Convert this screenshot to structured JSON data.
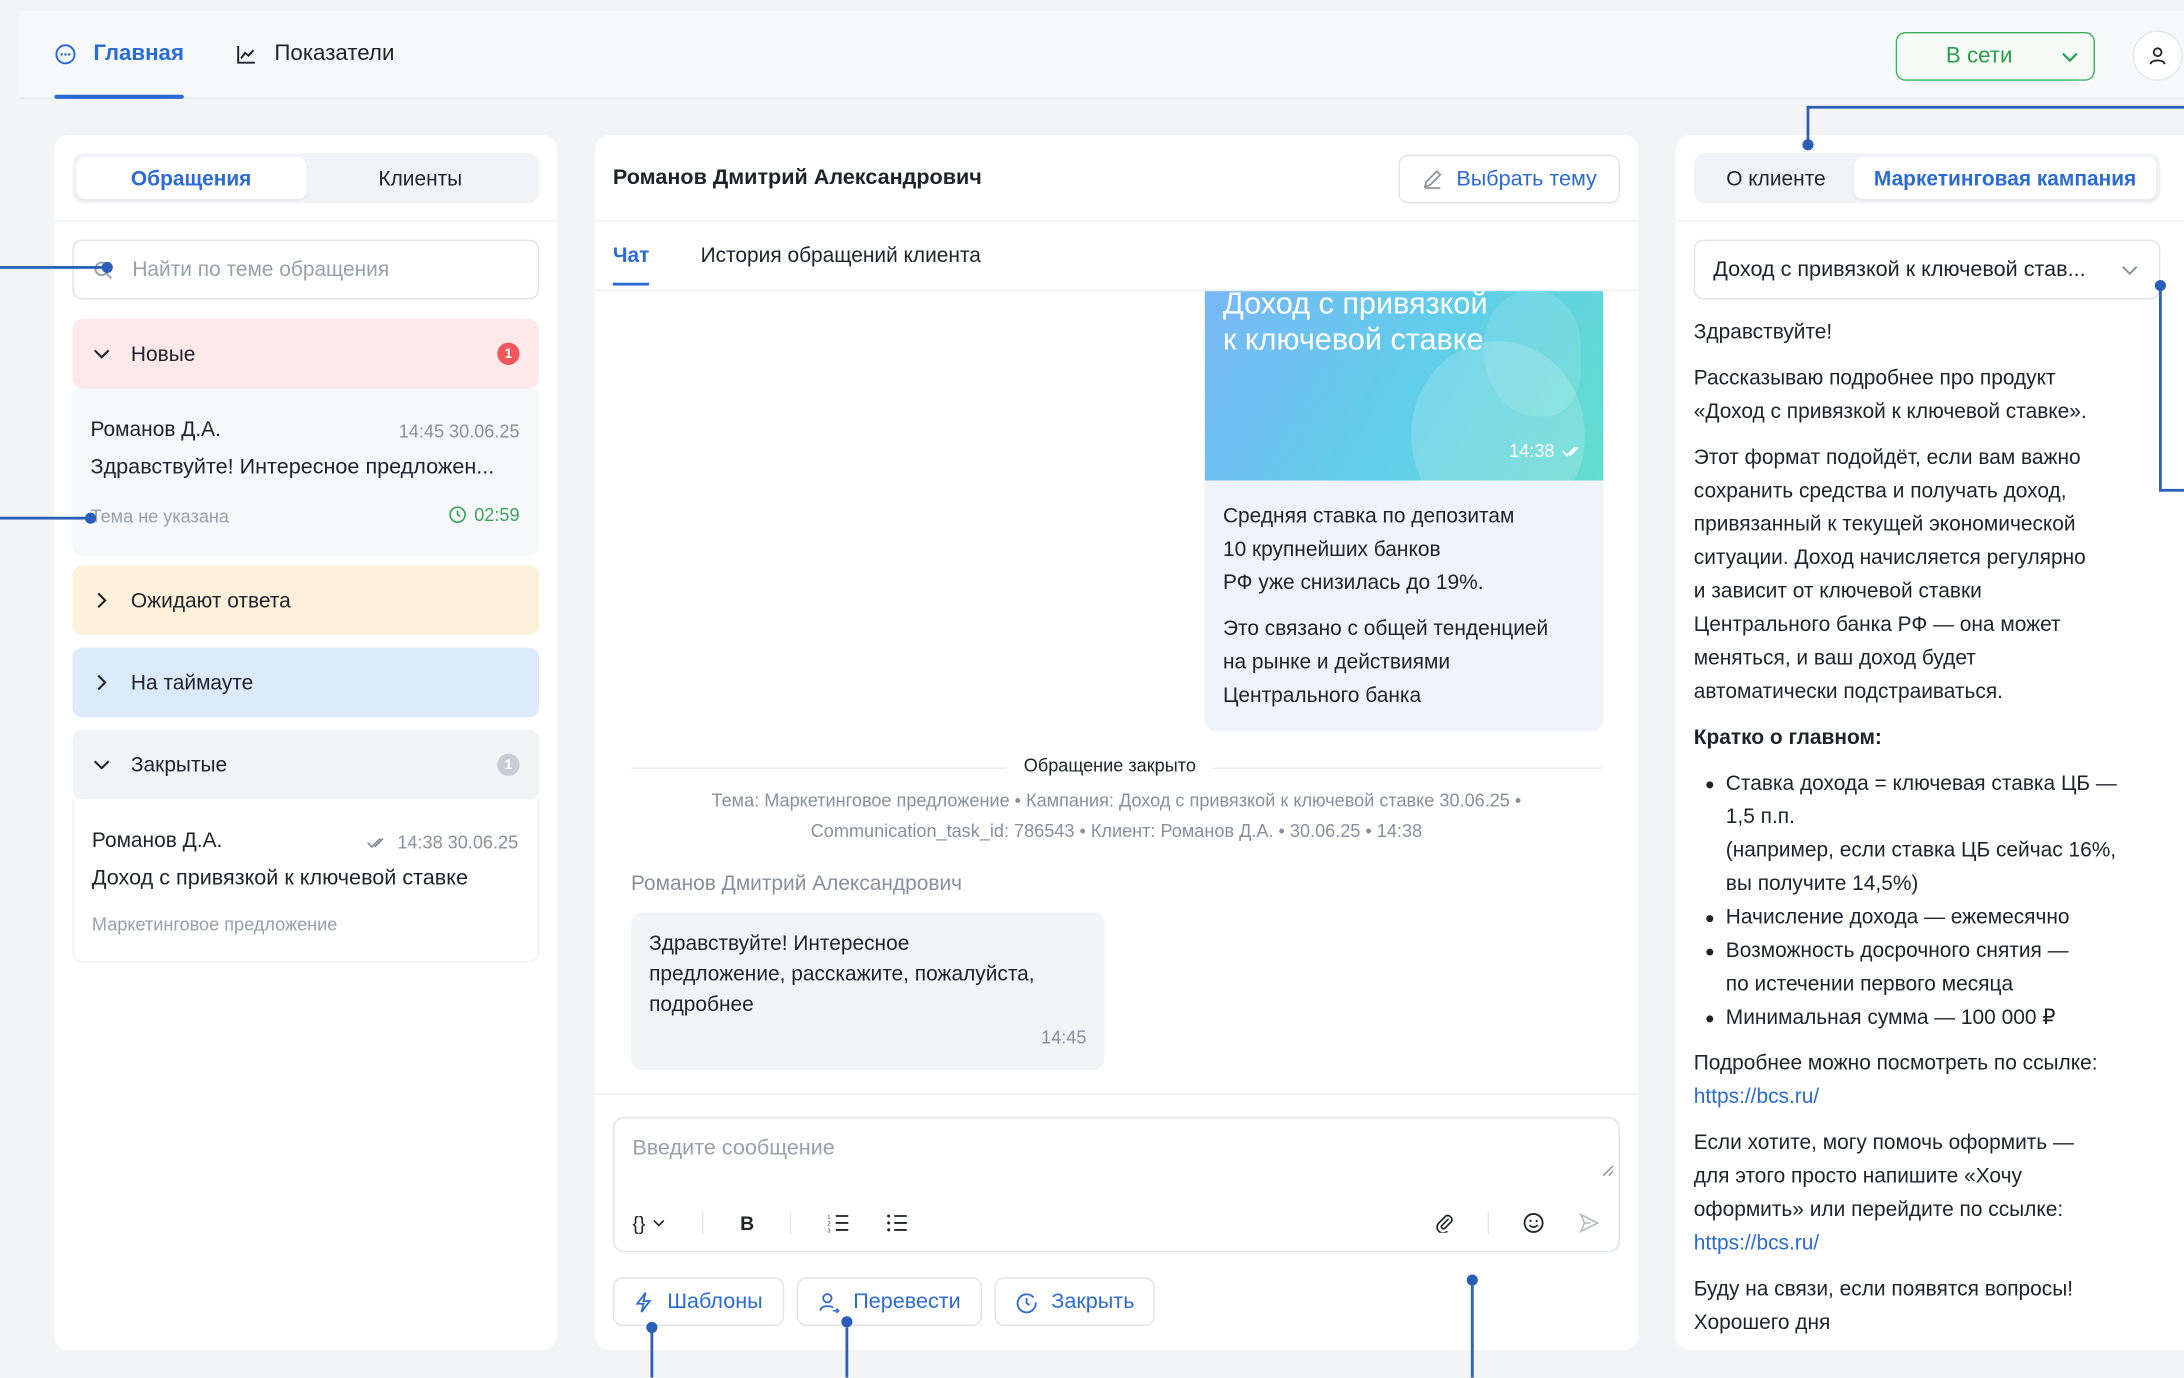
{
  "topbar": {
    "tabs": [
      {
        "label": "Главная",
        "icon": "chat-bubble-icon"
      },
      {
        "label": "Показатели",
        "icon": "line-chart-icon"
      }
    ],
    "status": "В сети",
    "status_color": "#3ab15c"
  },
  "left": {
    "tabs": [
      "Обращения",
      "Клиенты"
    ],
    "search_placeholder": "Найти по теме обращения",
    "groups": {
      "new": {
        "label": "Новые",
        "count": "1"
      },
      "waiting": {
        "label": "Ожидают ответа"
      },
      "timeout": {
        "label": "На таймауте"
      },
      "closed": {
        "label": "Закрытые",
        "count": "1"
      }
    },
    "new_card": {
      "name": "Романов Д.А.",
      "time": "14:45 30.06.25",
      "message": "Здравствуйте! Интересное предложен...",
      "topic": "Тема не указана",
      "timer": "02:59"
    },
    "closed_card": {
      "name": "Романов Д.А.",
      "time": "14:38 30.06.25",
      "message": "Доход с привязкой к ключевой ставке",
      "topic": "Маркетинговое предложение"
    }
  },
  "middle": {
    "client_name": "Романов Дмитрий Александрович",
    "choose_topic": "Выбрать тему",
    "tabs": [
      "Чат",
      "История обращений клиента"
    ],
    "promo": {
      "title_line1": "Доход с привязкой",
      "title_line2": "к ключевой ставке",
      "time": "14:38",
      "p1_l1": "Средняя ставка по депозитам",
      "p1_l2": "10 крупнейших банков",
      "p1_l3": "РФ уже снизилась до 19%.",
      "p2_l1": "Это связано с общей тенденцией",
      "p2_l2": "на рынке и действиями",
      "p2_l3": "Центрального банка"
    },
    "closed_label": "Обращение закрыто",
    "closed_meta_l1": "Тема: Маркетинговое предложение • Кампания: Доход с привязкой к ключевой ставке 30.06.25 •",
    "closed_meta_l2": "Communication_task_id: 786543 • Клиент: Романов Д.А. • 30.06.25 • 14:38",
    "sender": "Романов Дмитрий Александрович",
    "client_msg_l1": "Здравствуйте! Интересное",
    "client_msg_l2": "предложение, расскажите, пожалуйста,",
    "client_msg_l3": "подробнее",
    "client_msg_time": "14:45",
    "composer_placeholder": "Введите сообщение",
    "toolbar": {
      "vars": "{}",
      "bold": "B"
    },
    "actions": {
      "templates": "Шаблоны",
      "transfer": "Перевести",
      "close": "Закрыть"
    }
  },
  "right": {
    "tabs": [
      "О клиенте",
      "Маркетинговая кампания"
    ],
    "campaign_select": "Доход с привязкой к ключевой став...",
    "greeting": "Здравствуйте!",
    "intro_l1": "Рассказываю подробнее про продукт",
    "intro_l2": "«Доход с привязкой к ключевой ставке».",
    "desc_l1": "Этот формат подойдёт, если вам важно",
    "desc_l2": "сохранить средства и получать доход,",
    "desc_l3": "привязанный к текущей экономической",
    "desc_l4": "ситуации. Доход начисляется регулярно",
    "desc_l5": "и зависит от ключевой ставки",
    "desc_l6": "Центрального банка РФ — она может",
    "desc_l7": "меняться, и ваш доход будет",
    "desc_l8": "автоматически подстраиваться.",
    "summary_title": "Кратко о главном:",
    "b1_l1": "Ставка дохода = ключевая ставка ЦБ —",
    "b1_l2": "1,5 п.п.",
    "b1_l3": "(например, если ставка ЦБ сейчас 16%,",
    "b1_l4": "вы получите 14,5%)",
    "b2": "Начисление дохода — ежемесячно",
    "b3_l1": "Возможность досрочного снятия —",
    "b3_l2": "по истечении первого месяца",
    "b4": "Минимальная сумма — 100 000 ₽",
    "more": "Подробнее можно посмотреть по ссылке:",
    "link1": "https://bcs.ru/",
    "help_l1": "Если хотите, могу помочь оформить —",
    "help_l2": "для этого просто напишите «Хочу",
    "help_l3": "оформить» или перейдите по ссылке:",
    "link2": "https://bcs.ru/",
    "bye_l1": "Буду на связи, если появятся вопросы!",
    "bye_l2": "Хорошего дня"
  },
  "colors": {
    "accent": "#2a6bd6",
    "online": "#3ab15c",
    "new_bg": "#fde9ea",
    "wait_bg": "#fdf1db",
    "timeout_bg": "#dceafb"
  }
}
